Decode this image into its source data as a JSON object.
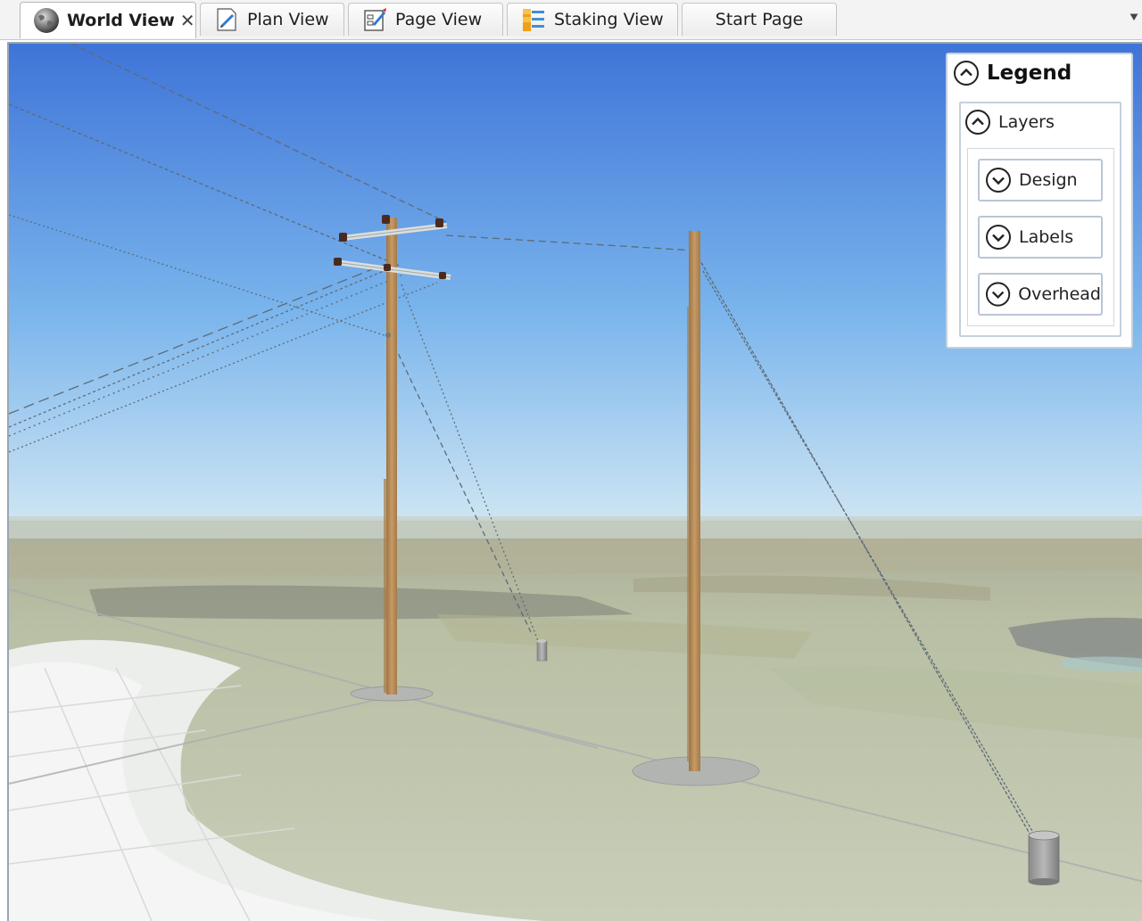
{
  "tabs": [
    {
      "label": "World View",
      "icon": "globe-icon",
      "active": true,
      "closable": true
    },
    {
      "label": "Plan View",
      "icon": "plan-document-icon",
      "active": false
    },
    {
      "label": "Page View",
      "icon": "page-edit-icon",
      "active": false
    },
    {
      "label": "Staking View",
      "icon": "staking-list-icon",
      "active": false
    },
    {
      "label": "Start Page",
      "icon": "",
      "active": false
    }
  ],
  "tab_close_glyph": "✕",
  "overflow_glyph": "⯆",
  "legend": {
    "title": "Legend",
    "collapse_icon": "chevron-up-circle-icon",
    "layers": {
      "title": "Layers",
      "collapse_icon": "chevron-up-circle-icon",
      "items": [
        {
          "label": "Design",
          "icon": "chevron-down-circle-icon"
        },
        {
          "label": "Labels",
          "icon": "chevron-down-circle-icon"
        },
        {
          "label": "Overhead",
          "icon": "chevron-down-circle-icon"
        }
      ]
    }
  },
  "scene": {
    "sky_top": "#3f74d8",
    "sky_horizon": "#cfe6f3",
    "pole_color": "#b58a58",
    "base_color": "#b4b6b4",
    "ground_color": "#c3c9b0"
  }
}
